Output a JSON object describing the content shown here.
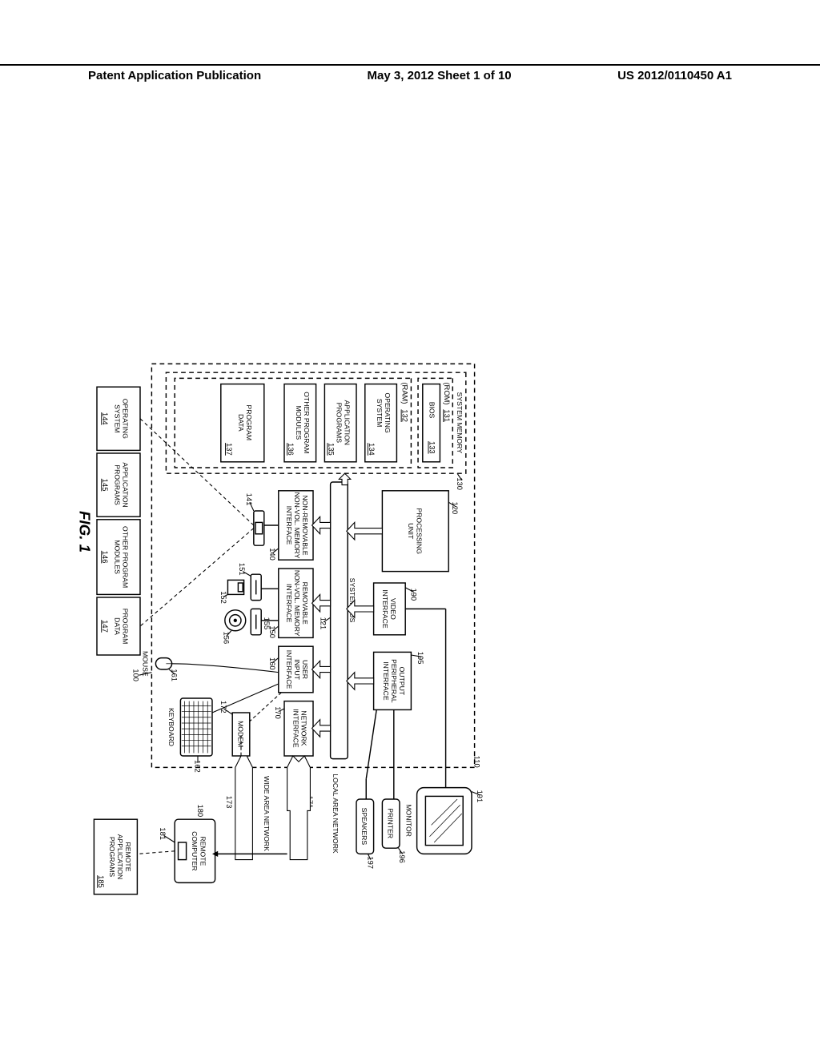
{
  "header": {
    "left": "Patent Application Publication",
    "center": "May 3, 2012   Sheet 1 of 10",
    "right": "US 2012/0110450 A1"
  },
  "figureLabel": "FIG. 1",
  "systemRef": "100",
  "computerRef": "110",
  "sysmem": {
    "title": "SYSTEM MEMORY",
    "ref": "130",
    "rom": {
      "label": "(ROM)",
      "ref": "131"
    },
    "bios": {
      "label": "BIOS",
      "ref": "133"
    },
    "ram": {
      "label": "(RAM)",
      "ref": "132"
    },
    "os": {
      "label1": "OPERATING",
      "label2": "SYSTEM",
      "ref": "134"
    },
    "apps": {
      "label1": "APPLICATION",
      "label2": "PROGRAMS",
      "ref": "135"
    },
    "other": {
      "label1": "OTHER PROGRAM",
      "label2": "MODULES",
      "ref": "136"
    },
    "data": {
      "label1": "PROGRAM",
      "label2": "DATA",
      "ref": "137"
    }
  },
  "cpu": {
    "label1": "PROCESSING",
    "label2": "UNIT",
    "ref": "120"
  },
  "video": {
    "label1": "VIDEO",
    "label2": "INTERFACE",
    "ref": "190"
  },
  "outputIf": {
    "label1": "OUTPUT",
    "label2": "PERIPHERAL",
    "label3": "INTERFACE",
    "ref": "195"
  },
  "sysbus": {
    "label": "SYSTEM BUS",
    "ref": "121"
  },
  "nonrem": {
    "label1": "NON-REMOVABLE",
    "label2": "NON-VOL. MEMORY",
    "label3": "INTERFACE",
    "ref": "140",
    "devref": "141"
  },
  "rem": {
    "label1": "REMOVABLE",
    "label2": "NON-VOL. MEMORY",
    "label3": "INTERFACE",
    "ref": "150"
  },
  "userIf": {
    "label1": "USER",
    "label2": "INPUT",
    "label3": "INTERFACE",
    "ref": "160"
  },
  "netIf": {
    "label1": "NETWORK",
    "label2": "INTERFACE",
    "ref": "170"
  },
  "modem": {
    "label": "MODEM",
    "ref": "172"
  },
  "floppySlot": {
    "ref": "151"
  },
  "floppyDisk": {
    "ref": "152"
  },
  "cdSlot": {
    "ref": "155"
  },
  "cdDisk": {
    "ref": "156"
  },
  "storage": {
    "os": {
      "label1": "OPERATING",
      "label2": "SYSTEM",
      "ref": "144"
    },
    "apps": {
      "label1": "APPLICATION",
      "label2": "PROGRAMS",
      "ref": "145"
    },
    "other": {
      "label1": "OTHER PROGRAM",
      "label2": "MODULES",
      "ref": "146"
    },
    "data": {
      "label1": "PROGRAM",
      "label2": "DATA",
      "ref": "147"
    }
  },
  "monitor": {
    "label": "MONITOR",
    "ref": "191"
  },
  "printer": {
    "label": "PRINTER",
    "ref": "196"
  },
  "speakers": {
    "label": "SPEAKERS",
    "ref": "197"
  },
  "mouse": {
    "label": "MOUSE",
    "ref": "161"
  },
  "keyboard": {
    "label": "KEYBOARD",
    "ref": "162"
  },
  "lan": {
    "label": "LOCAL AREA NETWORK",
    "ref": "171"
  },
  "wan": {
    "label": "WIDE AREA NETWORK",
    "ref": "173"
  },
  "remoteComputer": {
    "label1": "REMOTE",
    "label2": "COMPUTER",
    "ref": "180",
    "subref": "181"
  },
  "remoteApps": {
    "label1": "REMOTE",
    "label2": "APPLICATION",
    "label3": "PROGRAMS",
    "ref": "185"
  }
}
